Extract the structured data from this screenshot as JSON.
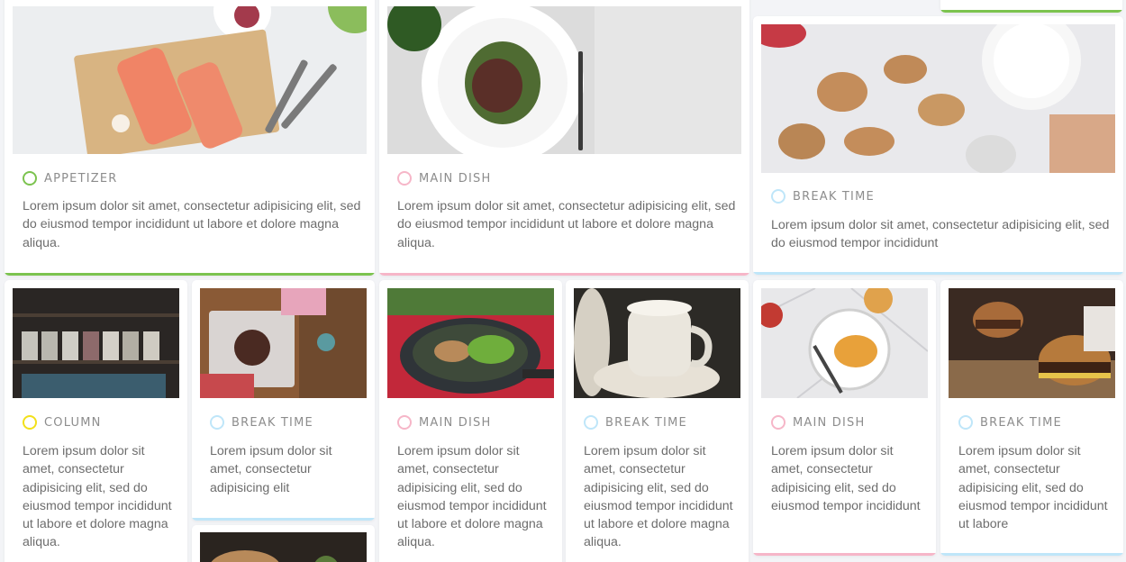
{
  "colors": {
    "appetizer": "#7cc34f",
    "main_dish": "#f6b6c8",
    "break_time": "#bfe6f9",
    "column": "#f2e01a"
  },
  "cards": [
    {
      "category": "APPETIZER",
      "image": "salmon-on-cutting-board-photo",
      "text": "Lorem ipsum dolor sit amet, consectetur adipisicing elit, sed do eiusmod tempor incididunt ut labore et dolore magna aliqua."
    },
    {
      "category": "MAIN DISH",
      "image": "steak-salad-plate-photo",
      "text": "Lorem ipsum dolor sit amet, consectetur adipisicing elit, sed do eiusmod tempor incididunt ut labore et dolore magna aliqua."
    },
    {
      "category": "BREAK TIME",
      "image": "decorated-animal-cookies-photo",
      "text": "Lorem ipsum dolor sit amet, consectetur adipisicing elit, sed do eiusmod tempor incididunt"
    },
    {
      "category": "COLUMN",
      "image": "tea-shelf-photo",
      "text": "Lorem ipsum dolor sit amet, consectetur adipisicing elit, sed do eiusmod tempor incididunt ut labore et dolore magna aliqua."
    },
    {
      "category": "BREAK TIME",
      "image": "dessert-tray-photo",
      "text": "Lorem ipsum dolor sit amet, consectetur adipisicing elit"
    },
    {
      "category": "MAIN DISH",
      "image": "stir-fry-pan-photo",
      "text": "Lorem ipsum dolor sit amet, consectetur adipisicing elit, sed do eiusmod tempor incididunt ut labore et dolore magna aliqua."
    },
    {
      "category": "BREAK TIME",
      "image": "coffee-cup-photo",
      "text": "Lorem ipsum dolor sit amet, consectetur adipisicing elit, sed do eiusmod tempor incididunt ut labore et dolore magna aliqua."
    },
    {
      "category": "MAIN DISH",
      "image": "plated-dish-marble-photo",
      "text": "Lorem ipsum dolor sit amet, consectetur adipisicing elit, sed do eiusmod tempor incididunt"
    },
    {
      "category": "BREAK TIME",
      "image": "burger-photo",
      "text": "Lorem ipsum dolor sit amet, consectetur adipisicing elit, sed do eiusmod tempor incididunt ut labore"
    },
    {
      "category": "",
      "image": "food-photo-partial",
      "text": ""
    }
  ]
}
